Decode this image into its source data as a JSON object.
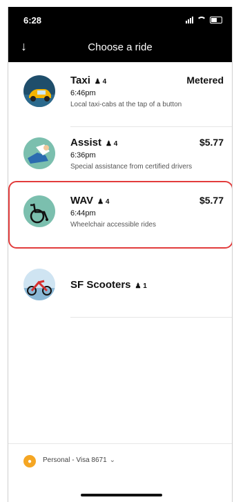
{
  "status_bar": {
    "time": "6:28"
  },
  "header": {
    "back_icon": "arrow-down-icon",
    "title": "Choose a ride"
  },
  "rides": [
    {
      "name": "Taxi",
      "capacity": "4",
      "eta": "6:46pm",
      "description": "Local taxi-cabs at the tap of a button",
      "price": "Metered",
      "icon": "taxi-icon"
    },
    {
      "name": "Assist",
      "capacity": "4",
      "eta": "6:36pm",
      "description": "Special assistance from certified drivers",
      "price": "$5.77",
      "icon": "assist-icon"
    },
    {
      "name": "WAV",
      "capacity": "4",
      "eta": "6:44pm",
      "description": "Wheelchair accessible rides",
      "price": "$5.77",
      "icon": "wheelchair-icon"
    },
    {
      "name": "SF Scooters",
      "capacity": "1",
      "eta": "",
      "description": "",
      "price": "",
      "icon": "scooter-icon"
    }
  ],
  "payment": {
    "label": "Personal - Visa 8671"
  },
  "colors": {
    "highlight": "#e23b3b",
    "header": "#000000",
    "accent_payment": "#f5a623"
  }
}
